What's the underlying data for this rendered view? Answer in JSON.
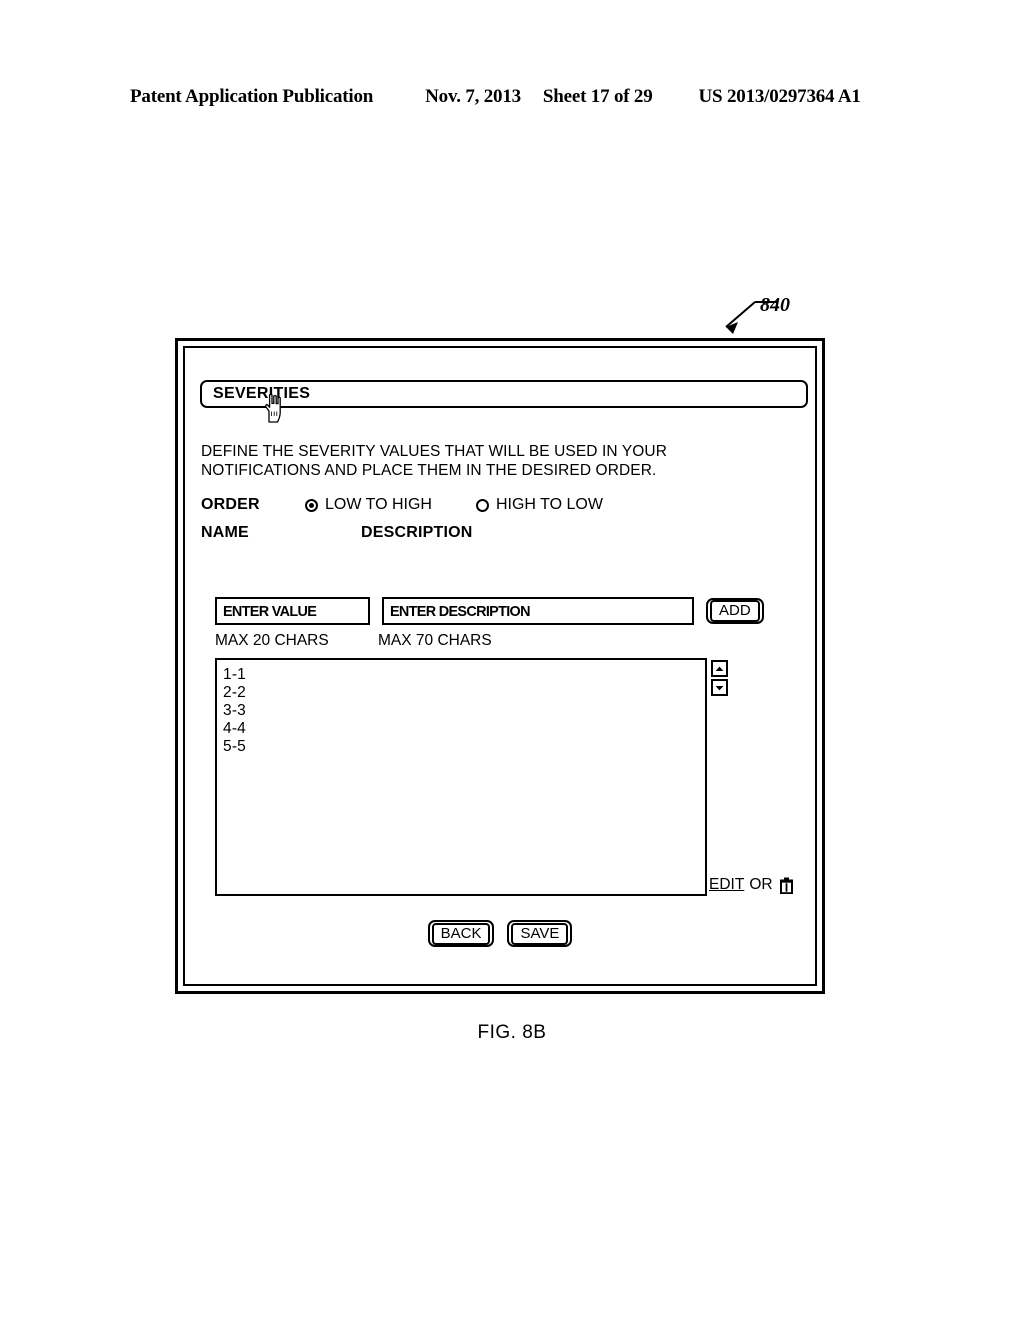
{
  "page_header": {
    "publication": "Patent Application Publication",
    "date": "Nov. 7, 2013",
    "sheet": "Sheet 17 of 29",
    "patent_number": "US 2013/0297364 A1"
  },
  "callout": {
    "reference_numeral": "840"
  },
  "dialog": {
    "title": "SEVERITIES",
    "description": "DEFINE THE SEVERITY VALUES THAT WILL BE USED IN YOUR NOTIFICATIONS AND PLACE THEM IN THE DESIRED ORDER.",
    "order": {
      "label": "ORDER",
      "options": [
        {
          "label": "LOW TO HIGH",
          "selected": true
        },
        {
          "label": "HIGH TO LOW",
          "selected": false
        }
      ]
    },
    "columns": {
      "name": "NAME",
      "description": "DESCRIPTION"
    },
    "fields": {
      "value_placeholder": "ENTER VALUE",
      "value_hint": "MAX 20 CHARS",
      "description_placeholder": "ENTER DESCRIPTION",
      "description_hint": "MAX 70 CHARS",
      "add_label": "ADD"
    },
    "list": {
      "items": [
        "1-1",
        "2-2",
        "3-3",
        "4-4",
        "5-5"
      ],
      "scroll_up_icon": "chevron-up-icon",
      "scroll_down_icon": "chevron-down-icon"
    },
    "actions": {
      "edit_label": "EDIT",
      "or_label": "OR",
      "delete_icon": "trash-icon",
      "back_label": "BACK",
      "save_label": "SAVE"
    },
    "cursor_icon": "pointing-hand-cursor"
  },
  "figure_caption": "FIG. 8B"
}
